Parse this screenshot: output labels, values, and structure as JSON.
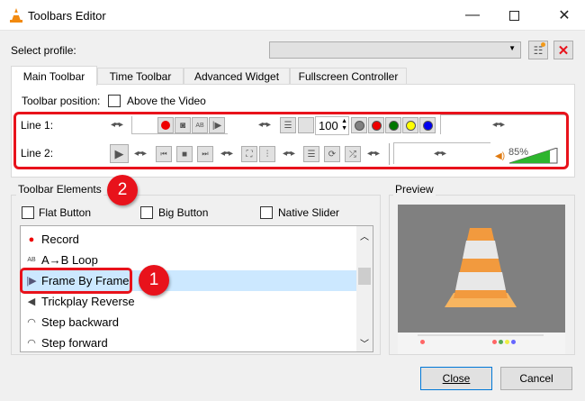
{
  "window": {
    "title": "Toolbars Editor"
  },
  "profile": {
    "label": "Select profile:",
    "value": ""
  },
  "tabs": [
    {
      "label": "Main Toolbar"
    },
    {
      "label": "Time Toolbar"
    },
    {
      "label": "Advanced Widget"
    },
    {
      "label": "Fullscreen Controller"
    }
  ],
  "toolbar_position": {
    "label": "Toolbar position:",
    "checkbox": "Above the Video"
  },
  "lines": {
    "line1": "Line 1:",
    "line2": "Line 2:",
    "speed_value": "100",
    "volume_percent": "85%",
    "volume_level": 85
  },
  "elements": {
    "title": "Toolbar Elements",
    "flat": "Flat Button",
    "big": "Big Button",
    "native": "Native Slider",
    "items": [
      {
        "label": "Record",
        "icon": "record-icon"
      },
      {
        "label": "A→B Loop",
        "icon": "ab-loop-icon"
      },
      {
        "label": "Frame By Frame",
        "icon": "frame-by-frame-icon"
      },
      {
        "label": "Trickplay Reverse",
        "icon": "reverse-icon"
      },
      {
        "label": "Step backward",
        "icon": "step-backward-icon"
      },
      {
        "label": "Step forward",
        "icon": "step-forward-icon"
      }
    ],
    "selected": "Frame By Frame"
  },
  "preview": {
    "title": "Preview"
  },
  "annotations": {
    "one": "1",
    "two": "2"
  },
  "buttons": {
    "close": "Close",
    "cancel": "Cancel"
  },
  "colors": {
    "highlight": "#e8121b",
    "selection": "#cce8ff"
  }
}
